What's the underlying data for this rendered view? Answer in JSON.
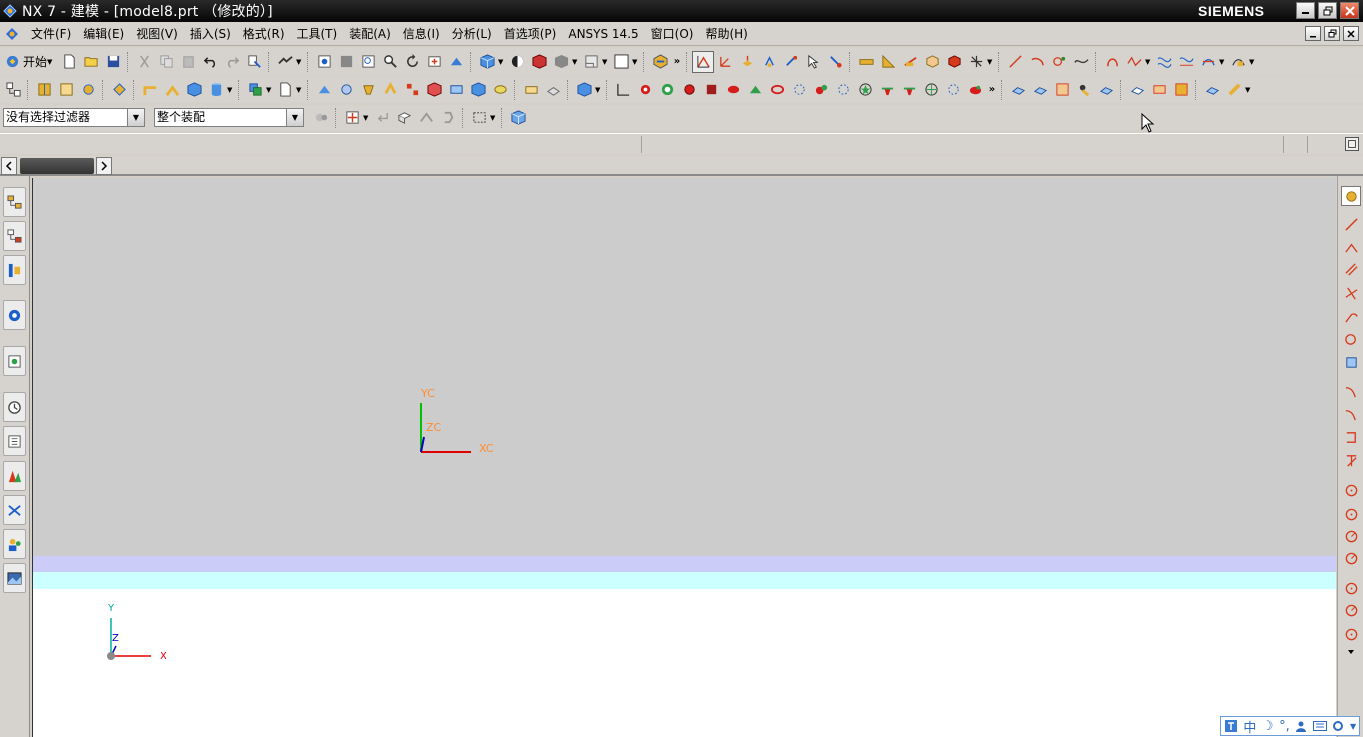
{
  "window": {
    "title": "NX 7 - 建模 - [model8.prt （修改的）]",
    "brand": "SIEMENS",
    "controls": [
      "minimize",
      "restore",
      "close"
    ]
  },
  "menubar": {
    "items": [
      {
        "id": "file",
        "label": "文件(F)"
      },
      {
        "id": "edit",
        "label": "编辑(E)"
      },
      {
        "id": "view",
        "label": "视图(V)"
      },
      {
        "id": "insert",
        "label": "插入(S)"
      },
      {
        "id": "format",
        "label": "格式(R)"
      },
      {
        "id": "tools",
        "label": "工具(T)"
      },
      {
        "id": "assembly",
        "label": "装配(A)"
      },
      {
        "id": "info",
        "label": "信息(I)"
      },
      {
        "id": "analysis",
        "label": "分析(L)"
      },
      {
        "id": "preferences",
        "label": "首选项(P)"
      },
      {
        "id": "ansys",
        "label": "ANSYS 14.5"
      },
      {
        "id": "window",
        "label": "窗口(O)"
      },
      {
        "id": "help",
        "label": "帮助(H)"
      }
    ]
  },
  "toolbar": {
    "start_label": "开始",
    "more_glyph": "»"
  },
  "filterbar": {
    "type_filter": "没有选择过滤器",
    "scope_filter": "整个装配"
  },
  "graphics": {
    "wcs": {
      "x": "XC",
      "y": "YC",
      "z": "ZC"
    },
    "triad": {
      "x": "X",
      "y": "Y",
      "z": "Z"
    },
    "colors": {
      "background_top": "#cccccc",
      "band_1": "#ccccf8",
      "band_2": "#ccffff",
      "background_bottom": "#ffffff",
      "axis_x": "#e00000",
      "axis_y": "#00c000",
      "axis_z": "#0000c0",
      "label": "#ff8c32"
    }
  },
  "ime": {
    "lang": "中",
    "moon": "☽",
    "deg": "°,"
  }
}
